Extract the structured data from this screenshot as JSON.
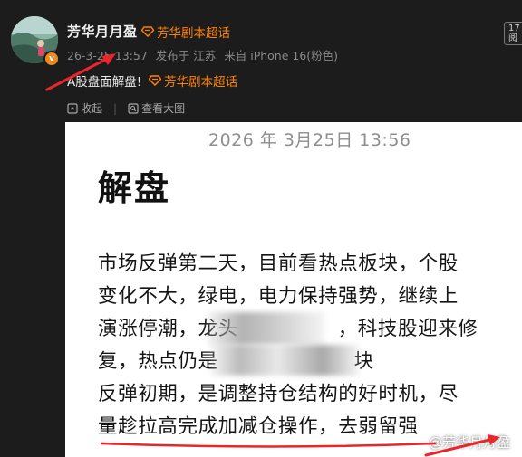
{
  "post": {
    "username": "芳华月月盈",
    "topic_tag": "芳华剧本超话",
    "meta": {
      "time": "26-3-25 13:57",
      "published_in": "发布于 江苏",
      "source": "来自 iPhone 16(粉色)"
    },
    "text": "A股盘面解盘!",
    "text_tag": "芳华剧本超话",
    "follow_box": {
      "line1": "17",
      "line2": "阅"
    }
  },
  "actions": {
    "collapse": "收起",
    "view_large": "查看大图"
  },
  "document": {
    "date": "2026 年 3月25日 13:56",
    "title": "解盘",
    "lines": [
      "市场反弹第二天，目前看热点板块，个股",
      "变化不大，绿电，电力保持强势，继续上",
      "演涨停潮，龙头",
      "复，热点仍是",
      "反弹初期，是调整持仓结构的好时机，尽",
      "量趁拉高完成加减仓操作，去弱留强"
    ],
    "line3_tail": "，科技股迎来修",
    "line4_tail": "块",
    "watermark": "@芳华月月盈"
  },
  "colors": {
    "background": "#1c1c1c",
    "accent_orange": "#ff8200",
    "annotation_red": "#e8262b"
  },
  "icons": [
    "avatar",
    "verified-badge-icon",
    "super-topic-icon",
    "collapse-icon",
    "view-large-icon",
    "weibo-logo-icon"
  ]
}
